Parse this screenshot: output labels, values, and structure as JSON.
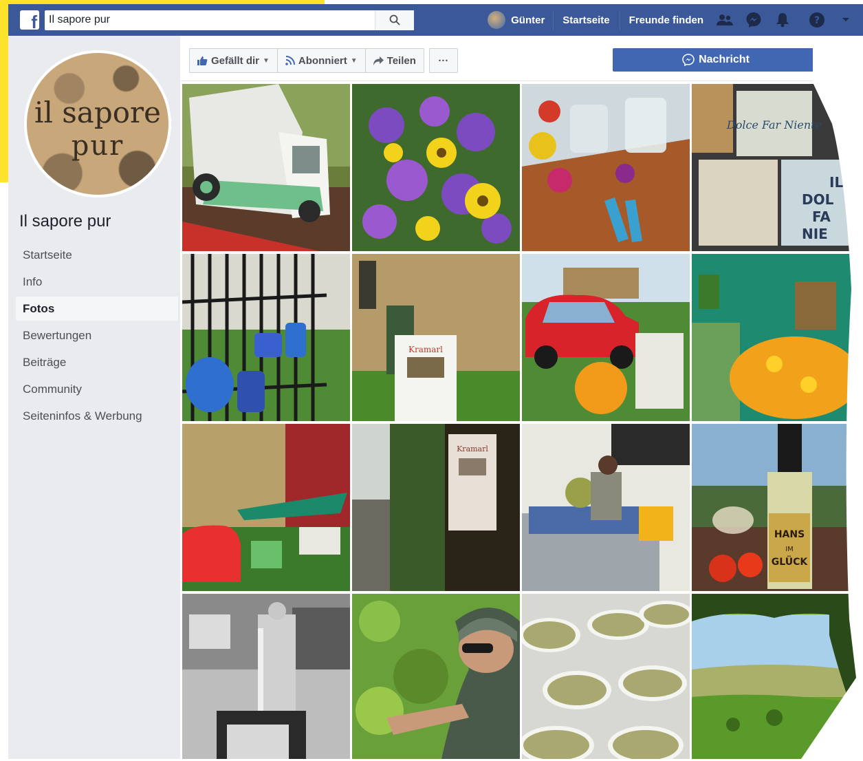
{
  "topbar": {
    "search_value": "Il sapore pur",
    "user_name": "Günter",
    "links": [
      "Startseite",
      "Freunde finden"
    ],
    "icons": [
      "friends-icon",
      "messenger-icon",
      "bell-icon",
      "help-icon",
      "dropdown-icon"
    ]
  },
  "page": {
    "name": "Il sapore pur",
    "logo_line1": "il sapore",
    "logo_line2": "pur"
  },
  "sidebar": {
    "items": [
      {
        "label": "Startseite"
      },
      {
        "label": "Info"
      },
      {
        "label": "Fotos",
        "active": true
      },
      {
        "label": "Bewertungen"
      },
      {
        "label": "Beiträge"
      },
      {
        "label": "Community"
      },
      {
        "label": "Seiteninfos & Werbung"
      }
    ]
  },
  "actions": {
    "like": "Gefällt dir",
    "follow": "Abonniert",
    "share": "Teilen",
    "more": "···",
    "message": "Nachricht"
  },
  "colors": {
    "brand": "#3b5998",
    "accent_yellow": "#fde32b",
    "message_button": "#4267b2",
    "sidebar_bg": "#e9ebee"
  },
  "photos": [
    {
      "subject": "ape-three-wheeler"
    },
    {
      "subject": "flower-bouquet"
    },
    {
      "subject": "table-flowers-jars"
    },
    {
      "subject": "dolce-far-niente-tiles",
      "text_visible": "Dolce Far Niente"
    },
    {
      "subject": "blue-jugs-fence"
    },
    {
      "subject": "old-house-poster",
      "text_visible": "Kramarl"
    },
    {
      "subject": "red-fiat-garden"
    },
    {
      "subject": "orange-flowers-shelf"
    },
    {
      "subject": "market-stand-red-car"
    },
    {
      "subject": "tree-poster",
      "text_visible": "Kramarl"
    },
    {
      "subject": "grape-press"
    },
    {
      "subject": "wine-bottle",
      "text_visible": "HANS IM GLÜCK"
    },
    {
      "subject": "bw-wine-cellar"
    },
    {
      "subject": "grape-harvest-woman"
    },
    {
      "subject": "grape-buckets"
    },
    {
      "subject": "vineyard-landscape"
    }
  ]
}
